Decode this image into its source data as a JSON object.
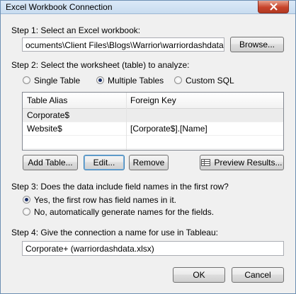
{
  "window": {
    "title": "Excel Workbook Connection"
  },
  "step1": {
    "label": "Step 1: Select an Excel workbook:",
    "path": "ocuments\\Client Files\\Blogs\\Warrior\\warriordashdata.xlsx",
    "browse_label": "Browse..."
  },
  "step2": {
    "label": "Step 2: Select the worksheet (table) to analyze:",
    "options": {
      "single": "Single Table",
      "multiple": "Multiple Tables",
      "custom": "Custom SQL"
    },
    "selected": "Multiple Tables",
    "table": {
      "headers": [
        "Table Alias",
        "Foreign Key"
      ],
      "rows": [
        {
          "alias": "Corporate$",
          "key": ""
        },
        {
          "alias": "Website$",
          "key": "[Corporate$].[Name]"
        }
      ]
    },
    "buttons": {
      "add": "Add Table...",
      "edit": "Edit...",
      "remove": "Remove",
      "preview": "Preview Results..."
    }
  },
  "step3": {
    "label": "Step 3: Does the data include field names in the first row?",
    "yes": "Yes, the first row has field names in it.",
    "no": "No, automatically generate names for the fields.",
    "selected": "yes"
  },
  "step4": {
    "label": "Step 4: Give the connection a name for use in Tableau:",
    "name": "Corporate+ (warriordashdata.xlsx)"
  },
  "footer": {
    "ok": "OK",
    "cancel": "Cancel"
  }
}
